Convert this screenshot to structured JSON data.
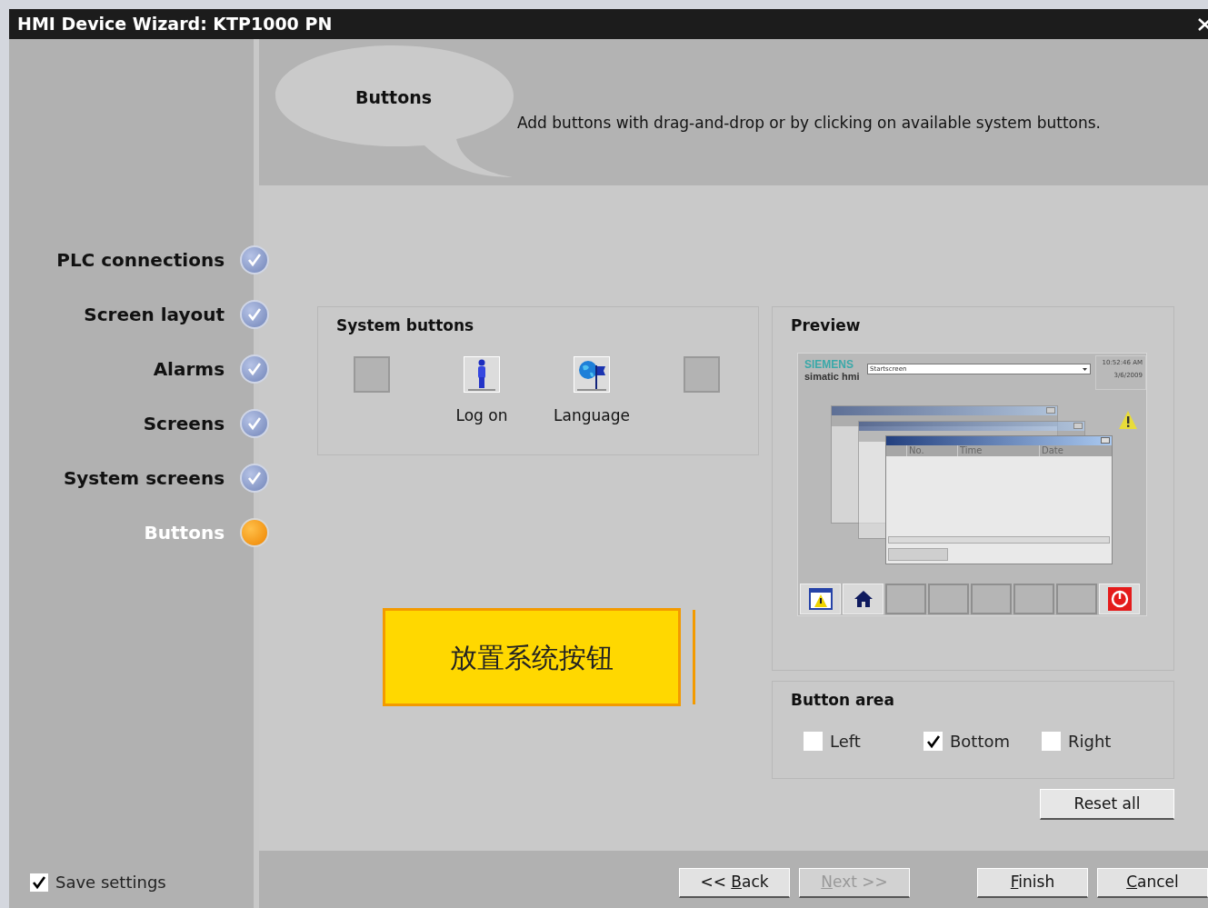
{
  "window": {
    "title": "HMI Device Wizard: KTP1000 PN"
  },
  "header": {
    "title": "Buttons",
    "description": "Add buttons with drag-and-drop or by clicking on available system buttons."
  },
  "steps": [
    {
      "label": "PLC connections",
      "selected": false
    },
    {
      "label": "Screen layout",
      "selected": false
    },
    {
      "label": "Alarms",
      "selected": false
    },
    {
      "label": "Screens",
      "selected": false
    },
    {
      "label": "System screens",
      "selected": false
    },
    {
      "label": "Buttons",
      "selected": true
    }
  ],
  "save_settings": {
    "label": "Save settings",
    "checked": true
  },
  "system_buttons": {
    "title": "System buttons",
    "slots": [
      {
        "kind": "empty"
      },
      {
        "kind": "logon",
        "label": "Log on"
      },
      {
        "kind": "language",
        "label": "Language"
      },
      {
        "kind": "empty"
      }
    ]
  },
  "callout": {
    "text": "放置系统按钮"
  },
  "preview": {
    "title": "Preview",
    "brand": "SIEMENS",
    "product": "simatic hmi",
    "screen_field": "Startscreen",
    "time": "10:52:46 AM",
    "date": "3/6/2009",
    "columns": [
      "No.",
      "Time",
      "Date"
    ],
    "bar_buttons": [
      {
        "kind": "alarm"
      },
      {
        "kind": "home"
      },
      {
        "kind": "empty"
      },
      {
        "kind": "empty"
      },
      {
        "kind": "empty"
      },
      {
        "kind": "empty"
      },
      {
        "kind": "empty"
      },
      {
        "kind": "power"
      }
    ]
  },
  "button_area": {
    "title": "Button area",
    "options": [
      {
        "label": "Left",
        "checked": false
      },
      {
        "label": "Bottom",
        "checked": true
      },
      {
        "label": "Right",
        "checked": false
      }
    ]
  },
  "reset_button": {
    "label": "Reset all"
  },
  "nav_buttons": [
    {
      "before": "<< ",
      "key": "B",
      "after": "ack",
      "disabled": false
    },
    {
      "key": "N",
      "after": "ext >>",
      "disabled": true
    },
    {
      "key": "F",
      "after": "inish",
      "disabled": false
    },
    {
      "key": "C",
      "after": "ancel",
      "disabled": false
    }
  ]
}
